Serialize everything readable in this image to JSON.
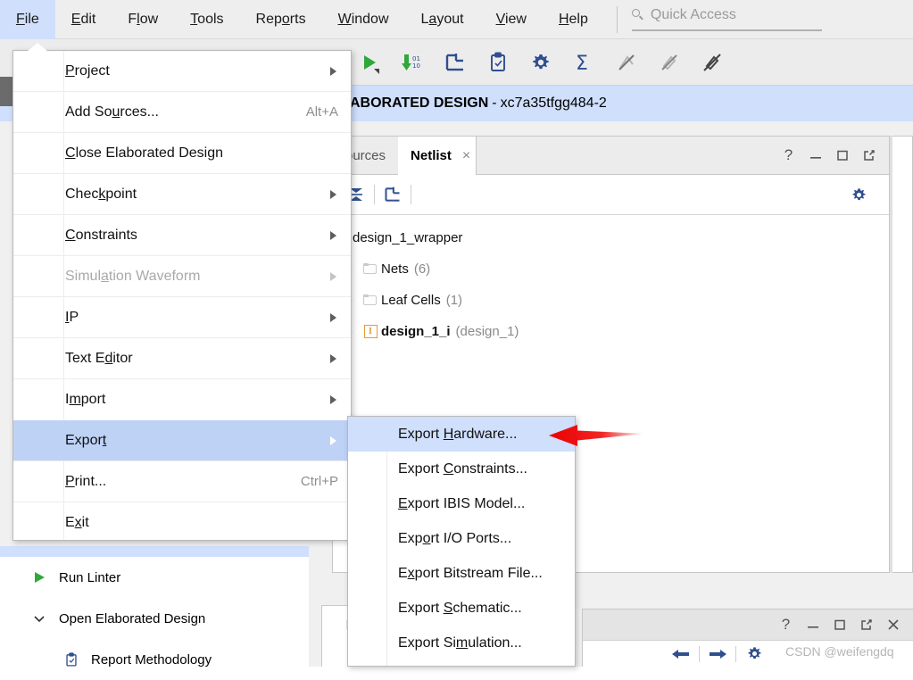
{
  "menubar": {
    "items": [
      {
        "label": "File",
        "mnemonic_index": 0,
        "active": true
      },
      {
        "label": "Edit",
        "mnemonic_index": 0,
        "active": false
      },
      {
        "label": "Flow",
        "mnemonic_index": 1,
        "active": false
      },
      {
        "label": "Tools",
        "mnemonic_index": 0,
        "active": false
      },
      {
        "label": "Reports",
        "mnemonic_index": 4,
        "active": false
      },
      {
        "label": "Window",
        "mnemonic_index": 0,
        "active": false
      },
      {
        "label": "Layout",
        "mnemonic_index": 1,
        "active": false
      },
      {
        "label": "View",
        "mnemonic_index": 0,
        "active": false
      },
      {
        "label": "Help",
        "mnemonic_index": 0,
        "active": false
      }
    ],
    "quick_access_placeholder": "Quick Access",
    "quick_access_icon": "search-icon"
  },
  "toolbar": {
    "buttons": [
      {
        "name": "run-synthesis-icon",
        "glyph": "play-green"
      },
      {
        "name": "download-binary-icon",
        "glyph": "arrow-down-green-01-10"
      },
      {
        "name": "schematic-icon",
        "glyph": "schematic-blue"
      },
      {
        "name": "report-clipboard-icon",
        "glyph": "clipboard-blue"
      },
      {
        "name": "settings-gear-icon",
        "glyph": "gear-blue"
      },
      {
        "name": "sum-sigma-icon",
        "glyph": "sigma-blue"
      },
      {
        "name": "no-marks-icon",
        "glyph": "marks-disabled"
      },
      {
        "name": "no-highlight-icon",
        "glyph": "highlight-disabled"
      },
      {
        "name": "unhighlight-icon",
        "glyph": "unhighlight"
      }
    ]
  },
  "design_title": {
    "prefix": "ELABORATED DESIGN",
    "visible_prefix": "ABORATED DESIGN",
    "dash": "-",
    "part": "xc7a35tfgg484-2"
  },
  "netlist_panel": {
    "tabs": [
      {
        "label": "ources",
        "full_label": "Sources",
        "selected": false,
        "closable": false
      },
      {
        "label": "Netlist",
        "selected": true,
        "closable": true,
        "close_glyph": "×"
      }
    ],
    "panel_controls": [
      {
        "name": "help-button",
        "glyph": "?"
      },
      {
        "name": "minimize-button",
        "glyph": "_"
      },
      {
        "name": "maximize-button",
        "glyph": "□"
      },
      {
        "name": "float-button",
        "glyph": "float"
      }
    ],
    "toolbar_buttons": [
      {
        "name": "collapse-all-icon",
        "glyph": "collapse"
      },
      {
        "name": "schematic-icon",
        "glyph": "schematic-blue"
      }
    ],
    "settings_icon": "gear-icon",
    "tree": [
      {
        "label": "design_1_wrapper",
        "count": "",
        "icon": "none",
        "expander": "none",
        "depth": 0
      },
      {
        "label": "Nets",
        "count": "(6)",
        "icon": "folder-icon",
        "expander": "›",
        "depth": 1
      },
      {
        "label": "Leaf Cells",
        "count": "(1)",
        "icon": "folder-icon",
        "expander": "›",
        "depth": 1
      },
      {
        "label": "design_1_i",
        "count": "(design_1)",
        "icon": "instance-icon",
        "icon_text": "I",
        "expander": "›",
        "depth": 1
      }
    ]
  },
  "file_menu": {
    "items": [
      {
        "label": "Project",
        "accel": "",
        "submenu": true,
        "disabled": false,
        "highlight": false,
        "mnemonic_index": 0
      },
      {
        "label": "Add Sources...",
        "accel": "Alt+A",
        "submenu": false,
        "disabled": false,
        "highlight": false,
        "mnemonic_index": 6
      },
      {
        "label": "Close Elaborated Design",
        "accel": "",
        "submenu": false,
        "disabled": false,
        "highlight": false,
        "mnemonic_index": 0
      },
      {
        "label": "Checkpoint",
        "accel": "",
        "submenu": true,
        "disabled": false,
        "highlight": false,
        "mnemonic_index": 5
      },
      {
        "label": "Constraints",
        "accel": "",
        "submenu": true,
        "disabled": false,
        "highlight": false,
        "mnemonic_index": 0
      },
      {
        "label": "Simulation Waveform",
        "accel": "",
        "submenu": true,
        "disabled": true,
        "highlight": false,
        "mnemonic_index": 6
      },
      {
        "label": "IP",
        "accel": "",
        "submenu": true,
        "disabled": false,
        "highlight": false,
        "mnemonic_index": 0
      },
      {
        "label": "Text Editor",
        "accel": "",
        "submenu": true,
        "disabled": false,
        "highlight": false,
        "mnemonic_index": 6
      },
      {
        "label": "Import",
        "accel": "",
        "submenu": true,
        "disabled": false,
        "highlight": false,
        "mnemonic_index": 1
      },
      {
        "label": "Export",
        "accel": "",
        "submenu": true,
        "disabled": false,
        "highlight": true,
        "mnemonic_index": 5
      },
      {
        "label": "Print...",
        "accel": "Ctrl+P",
        "submenu": false,
        "disabled": false,
        "highlight": false,
        "mnemonic_index": 0
      },
      {
        "label": "Exit",
        "accel": "",
        "submenu": false,
        "disabled": false,
        "highlight": false,
        "mnemonic_index": 1
      }
    ]
  },
  "export_menu": {
    "items": [
      {
        "label": "Export Hardware...",
        "highlight": true,
        "mnemonic_index": 7
      },
      {
        "label": "Export Constraints...",
        "highlight": false,
        "mnemonic_index": 7
      },
      {
        "label": "Export IBIS Model...",
        "highlight": false,
        "mnemonic_index": 1
      },
      {
        "label": "Export I/O Ports...",
        "highlight": false,
        "mnemonic_index": 4
      },
      {
        "label": "Export Bitstream File...",
        "highlight": false,
        "mnemonic_index": 1
      },
      {
        "label": "Export Schematic...",
        "highlight": false,
        "mnemonic_index": 7
      },
      {
        "label": "Export Simulation...",
        "highlight": false,
        "mnemonic_index": 9
      }
    ]
  },
  "flow_navigator": {
    "items": [
      {
        "label": "Run Linter",
        "icon": "play-green-icon",
        "indent": false
      },
      {
        "label": "Open Elaborated Design",
        "icon": "chevron-down-icon",
        "indent": false
      },
      {
        "label": "Report Methodology",
        "icon": "clipboard-icon",
        "indent": true
      }
    ]
  },
  "lower_right_panel": {
    "panel_controls": [
      {
        "name": "help-button",
        "glyph": "?"
      },
      {
        "name": "minimize-button",
        "glyph": "_"
      },
      {
        "name": "maximize-button",
        "glyph": "□"
      },
      {
        "name": "float-button",
        "glyph": "float"
      },
      {
        "name": "close-button",
        "glyph": "×"
      }
    ],
    "tool_buttons": [
      {
        "name": "back-arrow-icon",
        "glyph": "←"
      },
      {
        "name": "forward-arrow-icon",
        "glyph": "→"
      },
      {
        "name": "gear-icon",
        "glyph": "gear"
      }
    ]
  },
  "background_panel": {
    "io_tab_label": "I/"
  },
  "annotation": {
    "arrow_color": "#ee0000",
    "points_at": "Export Hardware..."
  },
  "watermark": {
    "text": "CSDN @weifengdq"
  },
  "colors": {
    "menu_highlight": "#bed2f5",
    "submenu_highlight": "#cfdffc",
    "title_band": "#cfdffc",
    "toolbar_bg": "#ececec",
    "accent_blue": "#2f4f8f",
    "accent_green": "#2fa83b",
    "accent_orange": "#e29a37"
  }
}
